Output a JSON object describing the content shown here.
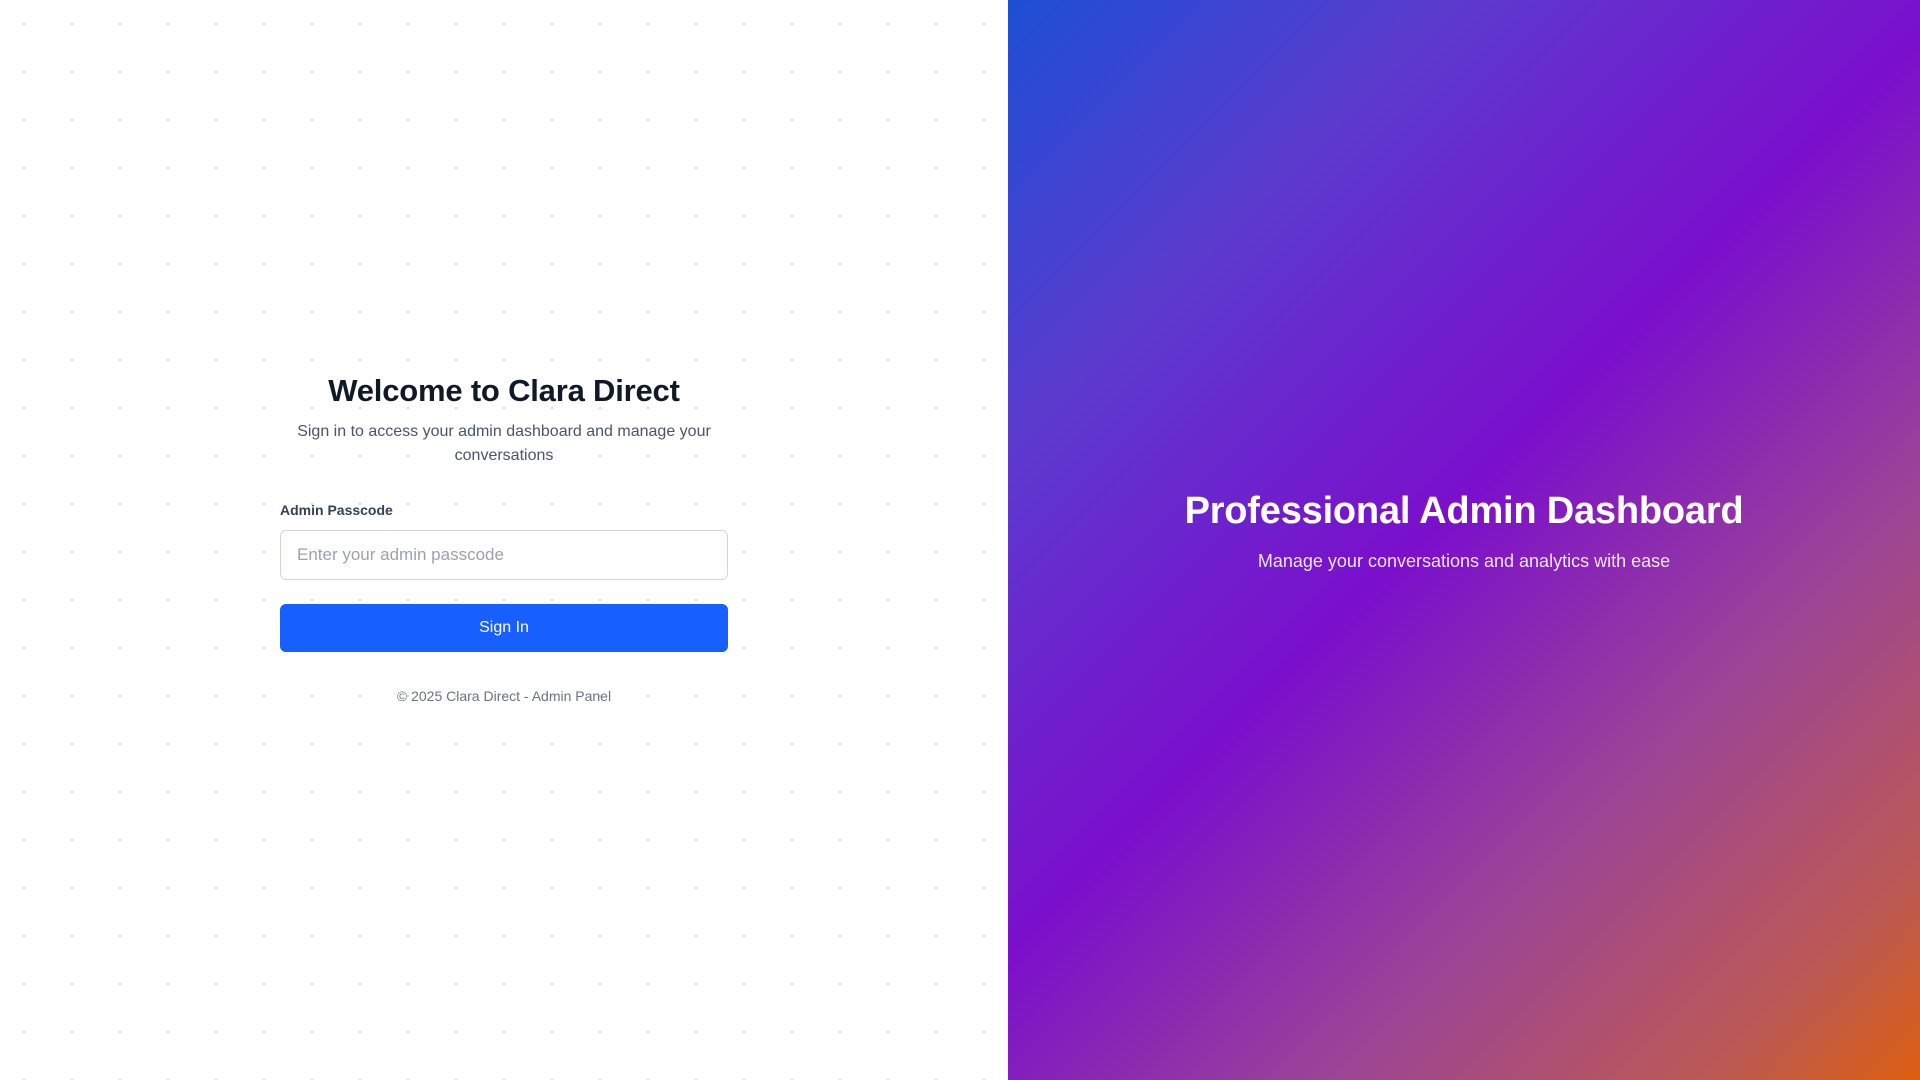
{
  "login": {
    "title": "Welcome to Clara Direct",
    "subtitle": "Sign in to access your admin dashboard and manage your conversations",
    "passcode_label": "Admin Passcode",
    "passcode_placeholder": "Enter your admin passcode",
    "passcode_value": "",
    "signin_label": "Sign In",
    "footer": "© 2025 Clara Direct - Admin Panel"
  },
  "hero": {
    "title": "Professional Admin Dashboard",
    "subtitle": "Manage your conversations and analytics with ease"
  },
  "colors": {
    "primary_button": "#175ffe",
    "title_text": "#111827",
    "gradient_start": "#1c4fd4",
    "gradient_mid": "#7b0fcc",
    "gradient_end": "#dc5e0e"
  }
}
